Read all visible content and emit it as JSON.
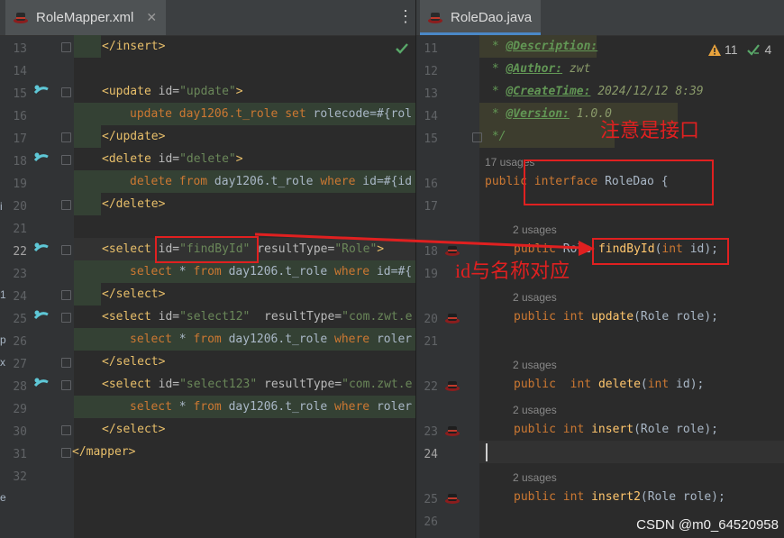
{
  "left_tab": {
    "title": "RoleMapper.xml",
    "close": "✕"
  },
  "right_tab": {
    "title": "RoleDao.java"
  },
  "inspections": {
    "warnings": "11",
    "checks": "4"
  },
  "left_lines": [
    "13",
    "14",
    "15",
    "16",
    "17",
    "18",
    "19",
    "20",
    "21",
    "22",
    "23",
    "24",
    "25",
    "26",
    "27",
    "28",
    "29",
    "30",
    "31",
    "32"
  ],
  "xml": {
    "l13_tag": "</insert>",
    "l15_open": "<update ",
    "l15_attr": "id=",
    "l15_val": "\"update\"",
    "l15_close": ">",
    "l16_a": "update day1206.t_role ",
    "l16_kw": "set",
    "l16_b": " rolecode=#{rol",
    "l17_tag": "</update>",
    "l18_open": "<delete ",
    "l18_attr": "id=",
    "l18_val": "\"delete\"",
    "l18_close": ">",
    "l19_kw1": "delete from",
    "l19_a": " day1206.t_role ",
    "l19_kw2": "where",
    "l19_b": " id=#{id",
    "l20_tag": "</delete>",
    "l22_open": "<select ",
    "l22_attr": "id=",
    "l22_val": "\"findById\"",
    "l22_attr2": " resultType=",
    "l22_val2": "\"Role\"",
    "l22_close": ">",
    "l23_kw1": "select",
    "l23_a": " * ",
    "l23_kw2": "from",
    "l23_b": " day1206.t_role ",
    "l23_kw3": "where",
    "l23_c": " id=#{",
    "l24_tag": "</select>",
    "l25_open": "<select ",
    "l25_attr": "id=",
    "l25_val": "\"select12\"",
    "l25_attr2": "  resultType=",
    "l25_val2": "\"com.zwt.e",
    "l26_kw1": "select",
    "l26_a": " * ",
    "l26_kw2": "from",
    "l26_b": " day1206.t_role ",
    "l26_kw3": "where",
    "l26_c": " roler",
    "l27_tag": "</select>",
    "l28_open": "<select ",
    "l28_attr": "id=",
    "l28_val": "\"select123\"",
    "l28_attr2": " resultType=",
    "l28_val2": "\"com.zwt.e",
    "l29_kw1": "select",
    "l29_a": " * ",
    "l29_kw2": "from",
    "l29_b": " day1206.t_role ",
    "l29_kw3": "where",
    "l29_c": " roler",
    "l30_tag": "</select>",
    "l31_tag": "</mapper>"
  },
  "java": {
    "l11_star": " * ",
    "l11_tag": "@Description:",
    "l12_star": " * ",
    "l12_tag": "@Author:",
    "l12_val": " zwt",
    "l13_star": " * ",
    "l13_tag": "@CreateTime:",
    "l13_val": " 2024/12/12 8:39",
    "l14_star": " * ",
    "l14_tag": "@Version:",
    "l14_val": " 1.0.0",
    "l15_end": " */",
    "u16": "17 usages",
    "l16_kw1": "public",
    "l16_kw2": " interface",
    "l16_rest": " RoleDao {",
    "u18": "2 usages",
    "l18_kw": "public",
    "l18_type": " Role ",
    "l18_fn": "findById",
    "l18_p1": "(",
    "l18_kw2": "int",
    "l18_p2": " id);",
    "u20": "2 usages",
    "l20_kw": "public",
    "l20_kw2": " int",
    "l20_sp": " ",
    "l20_fn": "update",
    "l20_rest": "(Role role);",
    "u22": "2 usages",
    "l22_kw": "public",
    "l22_kw2": "  int",
    "l22_sp": " ",
    "l22_fn": "delete",
    "l22_p1": "(",
    "l22_kw3": "int",
    "l22_p2": " id);",
    "u23": "2 usages",
    "l23_kw": "public",
    "l23_kw2": " int",
    "l23_sp": " ",
    "l23_fn": "insert",
    "l23_rest": "(Role role);",
    "u25": "2 usages",
    "l25_kw": "public",
    "l25_kw2": " int",
    "l25_sp": " ",
    "l25_fn": "insert2",
    "l25_rest": "(Role role);"
  },
  "right_lines": {
    "l11": "11",
    "l12": "12",
    "l13": "13",
    "l14": "14",
    "l15": "15",
    "l16": "16",
    "l17": "17",
    "l18": "18",
    "l19": "19",
    "l20": "20",
    "l21": "21",
    "l22": "22",
    "l23": "23",
    "l24": "24",
    "l25": "25",
    "l26": "26"
  },
  "annotations": {
    "interface_note": "注意是接口",
    "id_note": "id与名称对应"
  },
  "watermark": "CSDN @m0_64520958",
  "left_edge": {
    "a": "i",
    "b": "1",
    "c": "p",
    "d": "x",
    "e": "e"
  },
  "colors": {
    "annotation_red": "#e02020",
    "tab_accent": "#4a88c7",
    "keyword": "#cc7832",
    "string": "#6a8759",
    "method": "#ffc66d"
  }
}
